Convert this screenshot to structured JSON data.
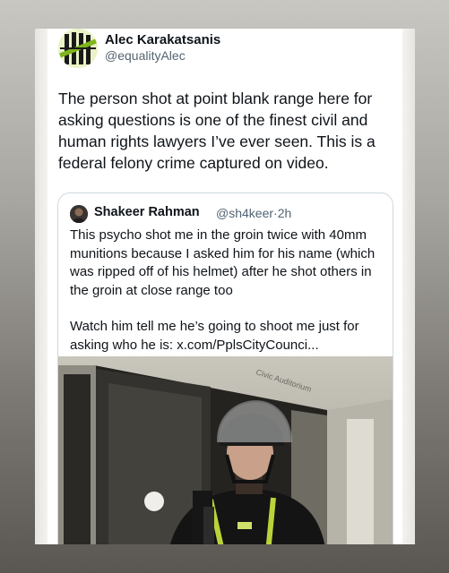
{
  "author": {
    "name": "Alec Karakatsanis",
    "handle": "@equalityAlec"
  },
  "tweet": {
    "text": "The person shot at point blank range here for asking questions is one of the finest civil and human rights lawyers I’ve ever seen. This is a federal felony crime captured on video."
  },
  "quoted_tweet": {
    "author_name": "Shakeer Rahman",
    "author_handle": "@sh4keer",
    "separator": "·",
    "time": "2h",
    "paragraph1": "This psycho shot me in the groin twice with 40mm munitions because I asked him for his name (which was ripped off of his helmet) after he shot others in the groin at close range too",
    "paragraph2": "Watch him tell me he’s going to shoot me just for asking who he is: x.com/PplsCityCounci...",
    "video_sign_text": "Civic Auditorium"
  }
}
